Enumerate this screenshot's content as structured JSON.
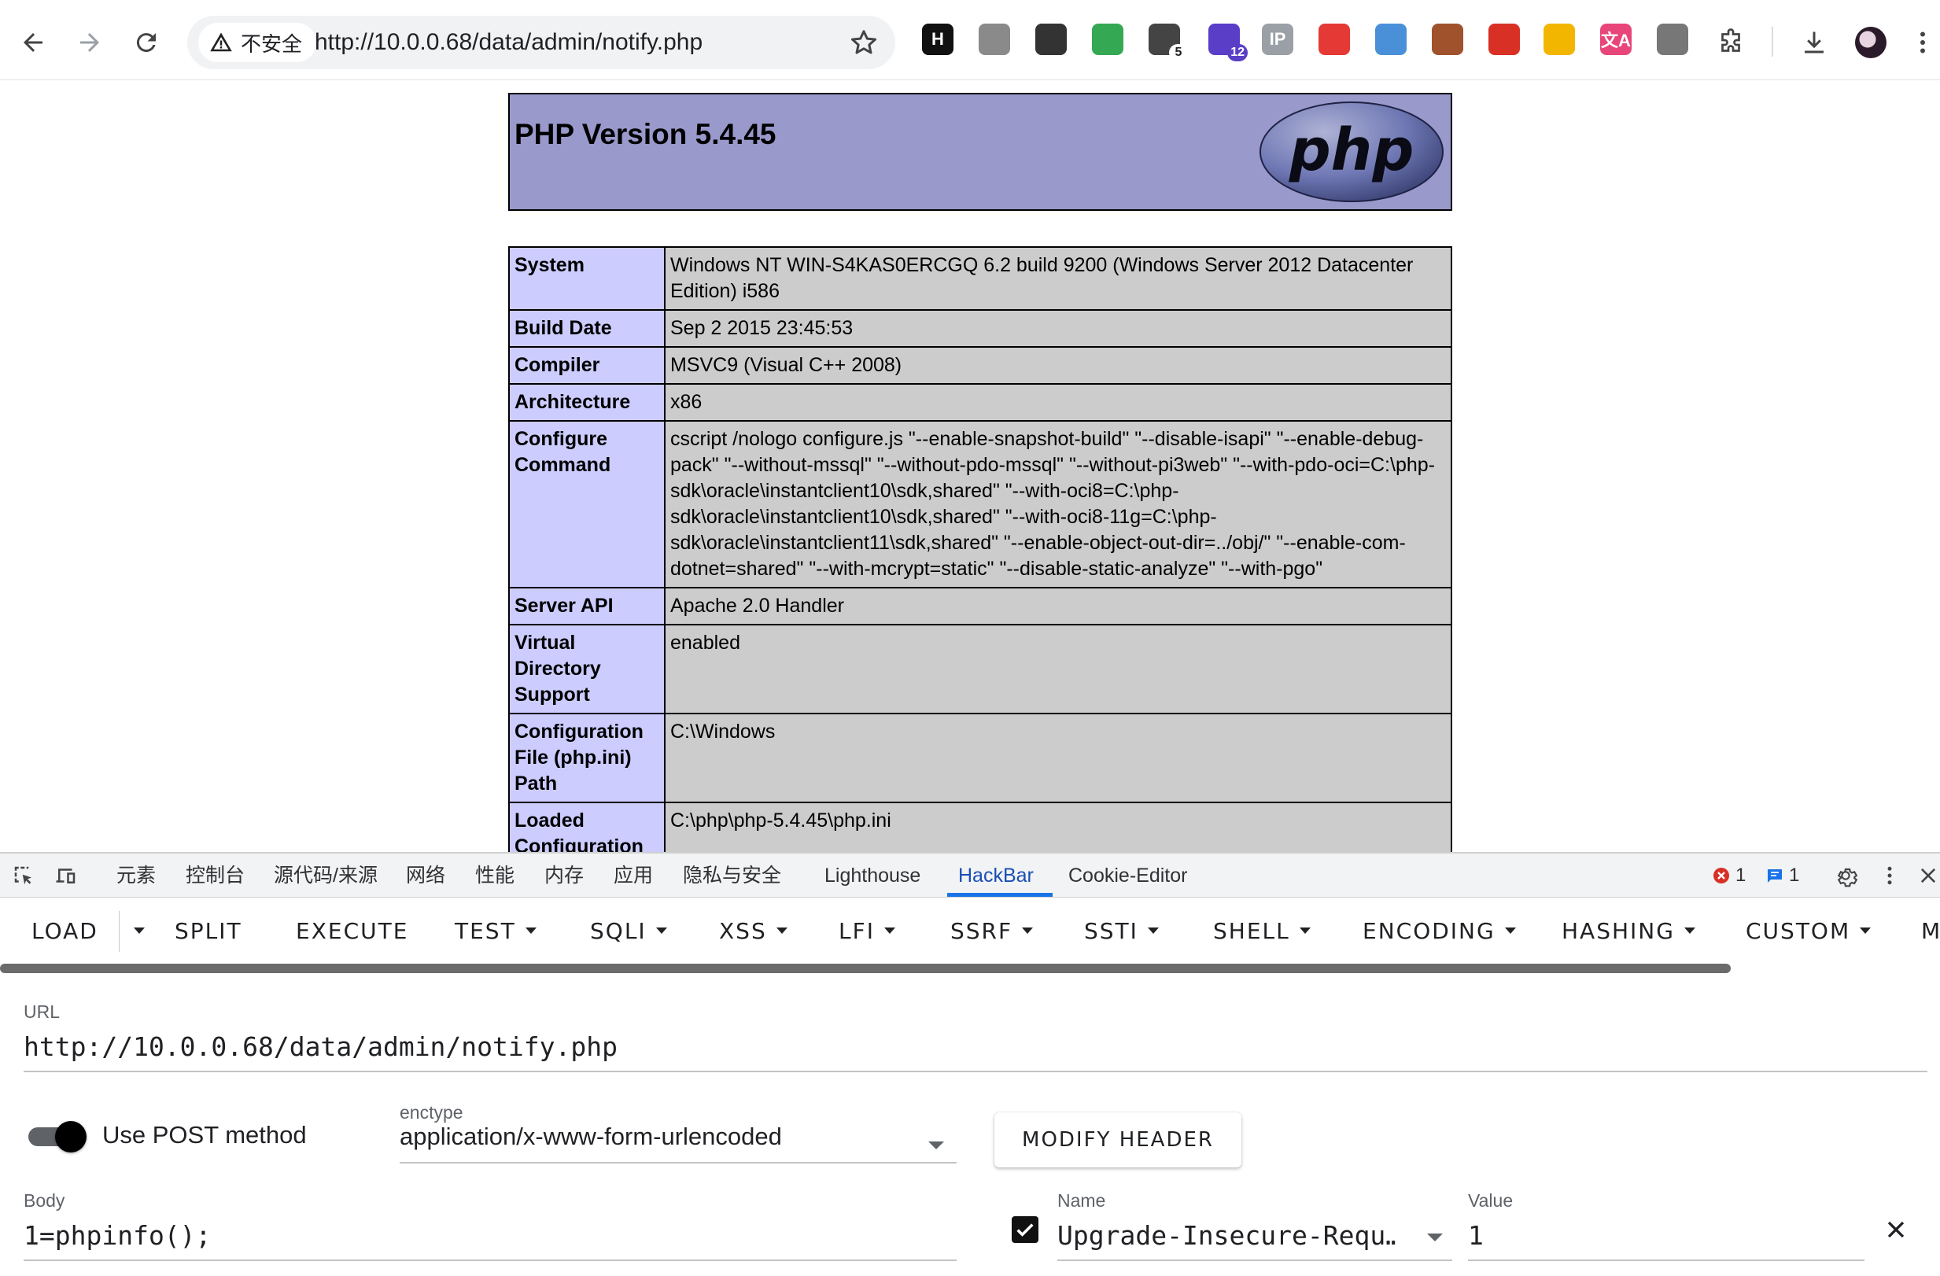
{
  "browser": {
    "security_label": "不安全",
    "url": "http://10.0.0.68/data/admin/notify.php",
    "extensions": [
      {
        "name": "hackbar-icon",
        "glyph": "H",
        "color": "#111111"
      },
      {
        "name": "record-icon",
        "glyph": "",
        "color": "#8a8a8a"
      },
      {
        "name": "hat-icon",
        "glyph": "",
        "color": "#333333"
      },
      {
        "name": "shield-check-icon",
        "glyph": "",
        "color": "#34a853"
      },
      {
        "name": "screenshot-icon",
        "glyph": "",
        "color": "#444444",
        "badge": "5"
      },
      {
        "name": "graduation-icon",
        "glyph": "",
        "color": "#5b3ec8",
        "badge": "12"
      },
      {
        "name": "ip-lookup-icon",
        "glyph": "IP",
        "color": "#9aa0a6"
      },
      {
        "name": "red-ext-icon",
        "glyph": "",
        "color": "#e53935"
      },
      {
        "name": "mask-icon",
        "glyph": "",
        "color": "#4a90d9"
      },
      {
        "name": "cookie-icon",
        "glyph": "",
        "color": "#a0522d"
      },
      {
        "name": "pokeball-icon",
        "glyph": "",
        "color": "#d93025"
      },
      {
        "name": "cat-icon",
        "glyph": "",
        "color": "#f2b600"
      },
      {
        "name": "translate-icon",
        "glyph": "文A",
        "color": "#e8457a"
      },
      {
        "name": "blocked-ext-icon",
        "glyph": "",
        "color": "#777777"
      }
    ]
  },
  "phpinfo": {
    "version_title": "PHP Version 5.4.45",
    "logo_text": "php",
    "rows": [
      {
        "key": "System",
        "value": "Windows NT WIN-S4KAS0ERCGQ 6.2 build 9200 (Windows Server 2012 Datacenter Edition) i586"
      },
      {
        "key": "Build Date",
        "value": "Sep 2 2015 23:45:53"
      },
      {
        "key": "Compiler",
        "value": "MSVC9 (Visual C++ 2008)"
      },
      {
        "key": "Architecture",
        "value": "x86"
      },
      {
        "key": "Configure Command",
        "value": "cscript /nologo configure.js \"--enable-snapshot-build\" \"--disable-isapi\" \"--enable-debug-pack\" \"--without-mssql\" \"--without-pdo-mssql\" \"--without-pi3web\" \"--with-pdo-oci=C:\\php-sdk\\oracle\\instantclient10\\sdk,shared\" \"--with-oci8=C:\\php-sdk\\oracle\\instantclient10\\sdk,shared\" \"--with-oci8-11g=C:\\php-sdk\\oracle\\instantclient11\\sdk,shared\" \"--enable-object-out-dir=../obj/\" \"--enable-com-dotnet=shared\" \"--with-mcrypt=static\" \"--disable-static-analyze\" \"--with-pgo\""
      },
      {
        "key": "Server API",
        "value": "Apache 2.0 Handler"
      },
      {
        "key": "Virtual Directory Support",
        "value": "enabled"
      },
      {
        "key": "Configuration File (php.ini) Path",
        "value": "C:\\Windows"
      },
      {
        "key": "Loaded Configuration",
        "value": "C:\\php\\php-5.4.45\\php.ini"
      }
    ]
  },
  "devtools": {
    "tabs": [
      "元素",
      "控制台",
      "源代码/来源",
      "网络",
      "性能",
      "内存",
      "应用",
      "隐私与安全",
      "Lighthouse",
      "HackBar",
      "Cookie-Editor"
    ],
    "active_tab": "HackBar",
    "error_count": "1",
    "message_count": "1"
  },
  "hackbar": {
    "menu": {
      "load": "LOAD",
      "split": "SPLIT",
      "execute": "EXECUTE",
      "test": "TEST",
      "sqli": "SQLI",
      "xss": "XSS",
      "lfi": "LFI",
      "ssrf": "SSRF",
      "ssti": "SSTI",
      "shell": "SHELL",
      "encoding": "ENCODING",
      "hashing": "HASHING",
      "custom": "CUSTOM",
      "more": "M"
    },
    "url_label": "URL",
    "url_value": "http://10.0.0.68/data/admin/notify.php",
    "post_label": "Use POST method",
    "post_enabled": true,
    "enctype_label": "enctype",
    "enctype_value": "application/x-www-form-urlencoded",
    "modify_header_label": "MODIFY HEADER",
    "body_label": "Body",
    "body_value": "1=phpinfo();",
    "header_name_label": "Name",
    "header_name_value": "Upgrade-Insecure-Requ…",
    "header_value_label": "Value",
    "header_value_value": "1",
    "header_enabled": true
  }
}
